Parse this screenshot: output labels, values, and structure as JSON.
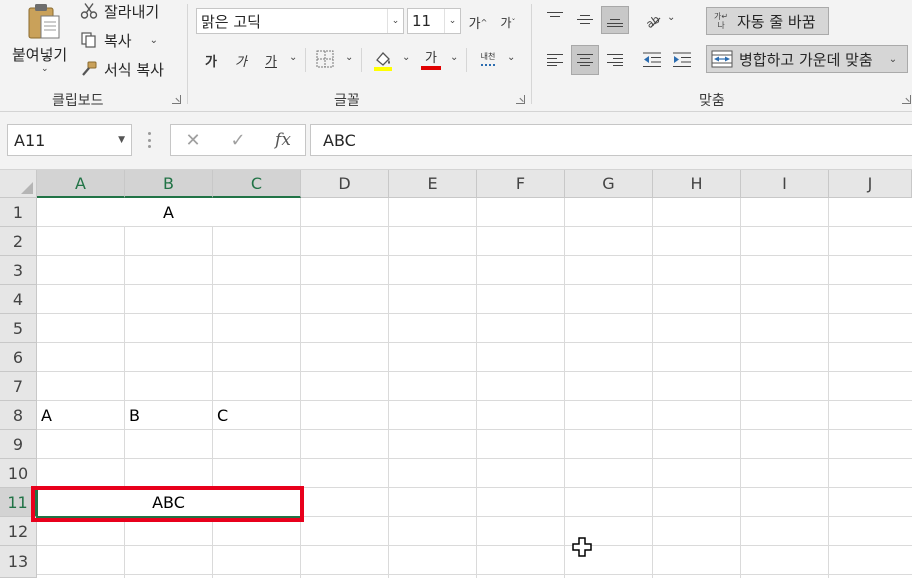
{
  "ribbon": {
    "clipboard": {
      "paste_label": "붙여넣기",
      "cut_label": "잘라내기",
      "copy_label": "복사",
      "format_painter_label": "서식 복사",
      "group_label": "클립보드"
    },
    "font": {
      "font_name": "맑은 고딕",
      "font_size": "11",
      "grow_label": "가",
      "shrink_label": "가",
      "bold_label": "가",
      "italic_label": "가",
      "underline_label": "가",
      "font_color_label": "가",
      "phonetic_label": "내천",
      "group_label": "글꼴",
      "fill_color": "#ffff00",
      "font_color": "#e00000"
    },
    "alignment": {
      "wrap_text_label": "자동 줄 바꿈",
      "merge_center_label": "병합하고 가운데 맞춤",
      "group_label": "맞춤"
    }
  },
  "formula_bar": {
    "name_box": "A11",
    "cancel_icon": "✕",
    "enter_icon": "✓",
    "fx_label": "fx",
    "value": "ABC"
  },
  "sheet": {
    "columns": [
      "A",
      "B",
      "C",
      "D",
      "E",
      "F",
      "G",
      "H",
      "I",
      "J"
    ],
    "rows": [
      "1",
      "2",
      "3",
      "4",
      "5",
      "6",
      "7",
      "8",
      "9",
      "10",
      "11",
      "12",
      "13"
    ],
    "selected_cell": "A11",
    "cells": {
      "A1_merged": "A",
      "A8": "A",
      "B8": "B",
      "C8": "C",
      "A11_merged": "ABC"
    },
    "highlight_color": "#e8001c",
    "accent_color": "#217346"
  }
}
